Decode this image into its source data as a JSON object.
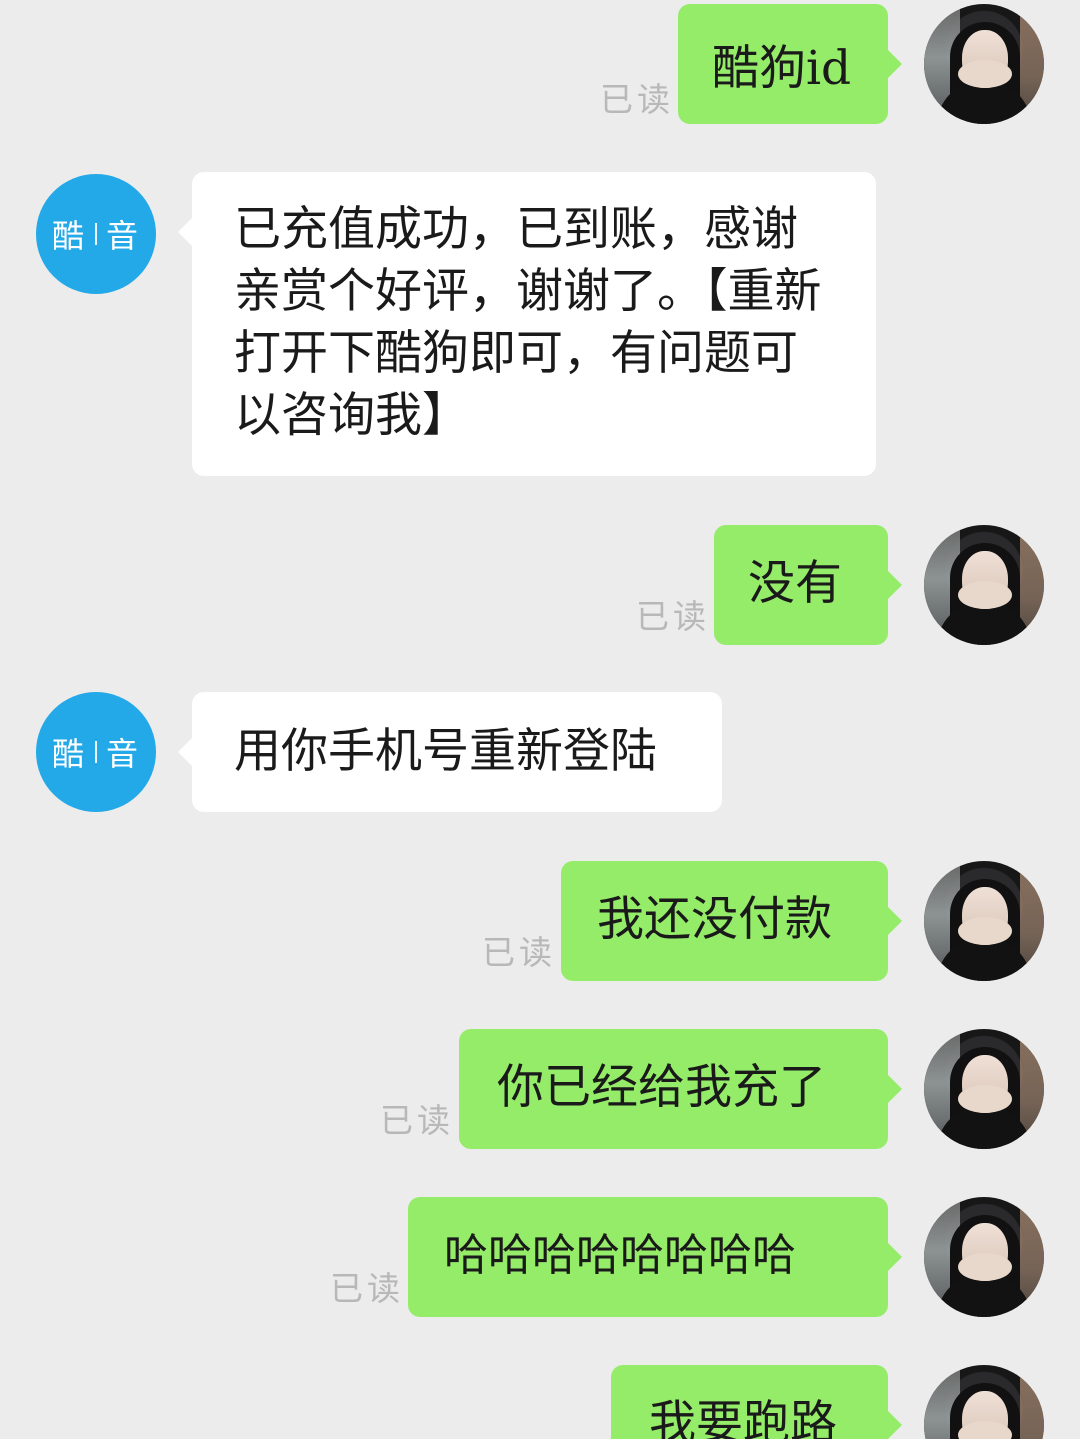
{
  "messages": [
    {
      "sender": "self",
      "text": "酷狗id",
      "status": "已读"
    },
    {
      "sender": "other",
      "avatar_text_left": "酷",
      "avatar_text_right": "音",
      "text": "已充值成功，已到账，感谢亲赏个好评，谢谢了。【重新打开下酷狗即可，有问题可以咨询我】"
    },
    {
      "sender": "self",
      "text": "没有",
      "status": "已读"
    },
    {
      "sender": "other",
      "avatar_text_left": "酷",
      "avatar_text_right": "音",
      "text": "用你手机号重新登陆"
    },
    {
      "sender": "self",
      "text": "我还没付款",
      "status": "已读"
    },
    {
      "sender": "self",
      "text": "你已经给我充了",
      "status": "已读"
    },
    {
      "sender": "self",
      "text": "哈哈哈哈哈哈哈哈",
      "status": "已读"
    },
    {
      "sender": "self",
      "text": "我要跑路",
      "status": ""
    }
  ],
  "colors": {
    "background": "#ececec",
    "self_bubble": "#95ec69",
    "other_bubble": "#ffffff",
    "other_avatar": "#23a8e8",
    "read_status": "#b8b8b8"
  },
  "icons": {
    "self_avatar": "user-photo-avatar",
    "other_avatar": "kuyin-avatar"
  }
}
